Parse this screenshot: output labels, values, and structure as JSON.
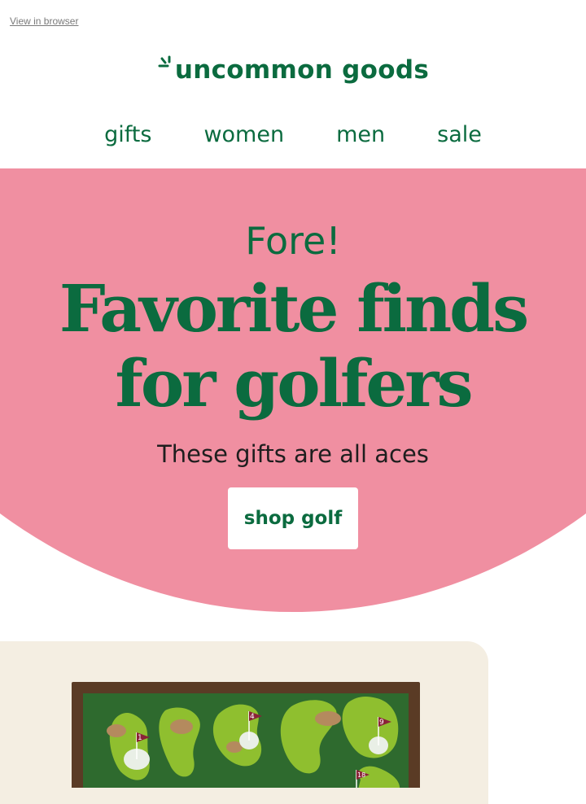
{
  "header": {
    "view_in_browser": "View in browser",
    "logo_text": "uncommon goods"
  },
  "nav": {
    "items": [
      {
        "label": "gifts"
      },
      {
        "label": "women"
      },
      {
        "label": "men"
      },
      {
        "label": "sale"
      }
    ]
  },
  "hero": {
    "eyebrow": "Fore!",
    "headline_line1": "Favorite finds",
    "headline_line2": "for golfers",
    "subhead": "These gifts are all aces",
    "cta_label": "shop golf"
  },
  "product": {
    "image_icon": "golf-course-corkboard",
    "hole_numbers": [
      "1",
      "4",
      "9",
      "18"
    ]
  },
  "colors": {
    "brand_green": "#0b6b3f",
    "hero_pink": "#f08fa1",
    "card_cream": "#f4eee2",
    "board_green": "#2e6a2e",
    "fairway_green": "#8fbf2f",
    "cork": "#b48a5e",
    "frame_wood": "#5a3b25",
    "flag_red": "#8a2238"
  }
}
